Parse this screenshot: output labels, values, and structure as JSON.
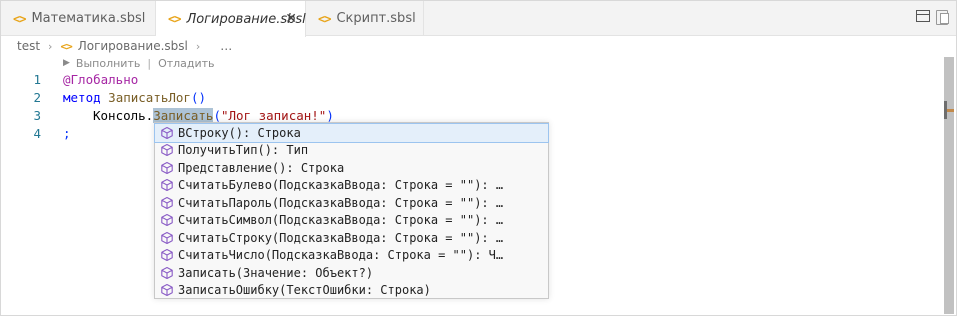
{
  "tabs": [
    {
      "label": "Математика.sbsl",
      "icon": "code-brackets-icon",
      "active": false
    },
    {
      "label": "Логирование.sbsl",
      "icon": "code-brackets-icon",
      "active": true,
      "close": "✕"
    },
    {
      "label": "Скрипт.sbsl",
      "icon": "code-brackets-icon",
      "active": false
    }
  ],
  "tab_icon_text": "<>",
  "breadcrumb": {
    "root": "test",
    "file": "Логирование.sbsl",
    "more": "…"
  },
  "codelens": {
    "run": "Выполнить",
    "separator": "|",
    "debug": "Отладить"
  },
  "lines": [
    {
      "number": "1",
      "text": "@Глобально"
    },
    {
      "number": "2",
      "keyword": "метод",
      "name": "ЗаписатьЛог",
      "parens": "()"
    },
    {
      "number": "3",
      "object": "Консоль.",
      "member": "Записать",
      "open": "(",
      "string": "\"Лог записан!\"",
      "close": ")"
    },
    {
      "number": "4",
      "text": ";"
    }
  ],
  "suggestions": [
    "ВСтроку(): Строка",
    "ПолучитьТип(): Тип",
    "Представление(): Строка",
    "СчитатьБулево(ПодсказкаВвода: Строка = \"\"): …",
    "СчитатьПароль(ПодсказкаВвода: Строка = \"\"): …",
    "СчитатьСимвол(ПодсказкаВвода: Строка = \"\"): …",
    "СчитатьСтроку(ПодсказкаВвода: Строка = \"\"): …",
    "СчитатьЧисло(ПодсказкаВвода: Строка = \"\"): Ч…",
    "Записать(Значение: Объект?)",
    "ЗаписатьОшибку(ТекстОшибки: Строка)"
  ],
  "selected_suggestion": 0,
  "colors": {
    "accent_icon": "#e8a317",
    "suggestion_icon": "#8a5cc6",
    "line_numbers": "#237893"
  }
}
